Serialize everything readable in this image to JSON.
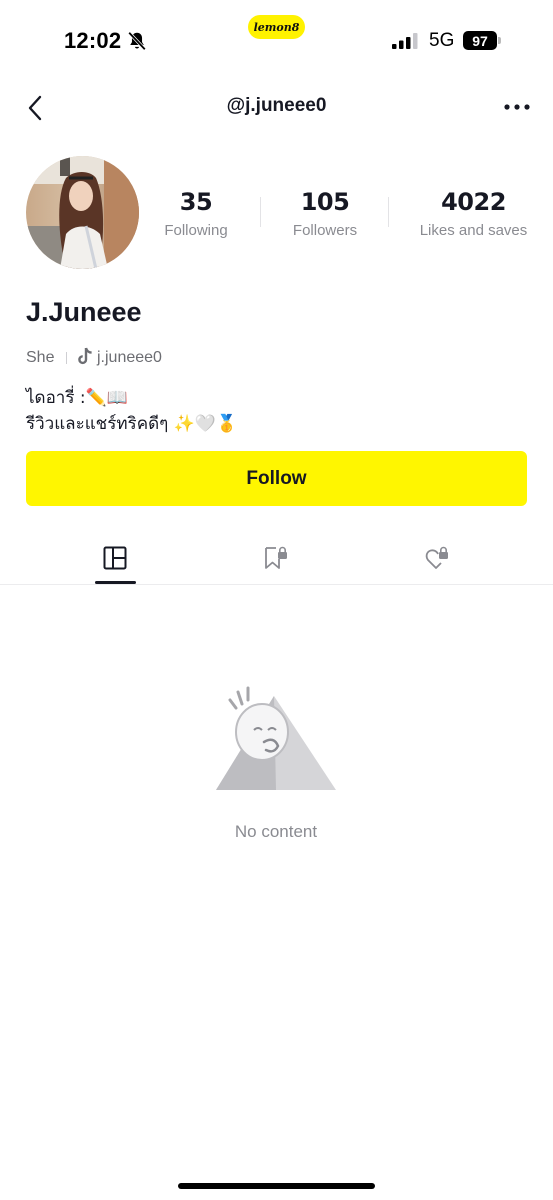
{
  "status_bar": {
    "time": "12:02",
    "network": "5G",
    "battery": "97"
  },
  "app_badge": "lemon8",
  "header": {
    "handle": "@j.juneee0",
    "back_icon": "chevron-left-icon",
    "more_icon": "more-horizontal-icon"
  },
  "profile": {
    "display_name": "J.Juneee",
    "pronoun": "She",
    "linked_account": "j.juneee0",
    "bio_lines": [
      "ไดอารี่ :✏️📖",
      "รีวิวและแชร์ทริคดีๆ ✨🤍🥇"
    ]
  },
  "stats": [
    {
      "value": "35",
      "label": "Following"
    },
    {
      "value": "105",
      "label": "Followers"
    },
    {
      "value": "4022",
      "label": "Likes and saves"
    }
  ],
  "follow_button": {
    "label": "Follow",
    "color": "#fff600"
  },
  "tabs": [
    {
      "icon": "posts-grid-icon",
      "selected": true
    },
    {
      "icon": "saved-locked-icon",
      "selected": false
    },
    {
      "icon": "liked-locked-icon",
      "selected": false
    }
  ],
  "empty_state": {
    "text": "No content",
    "icon": "no-content-illustration"
  }
}
